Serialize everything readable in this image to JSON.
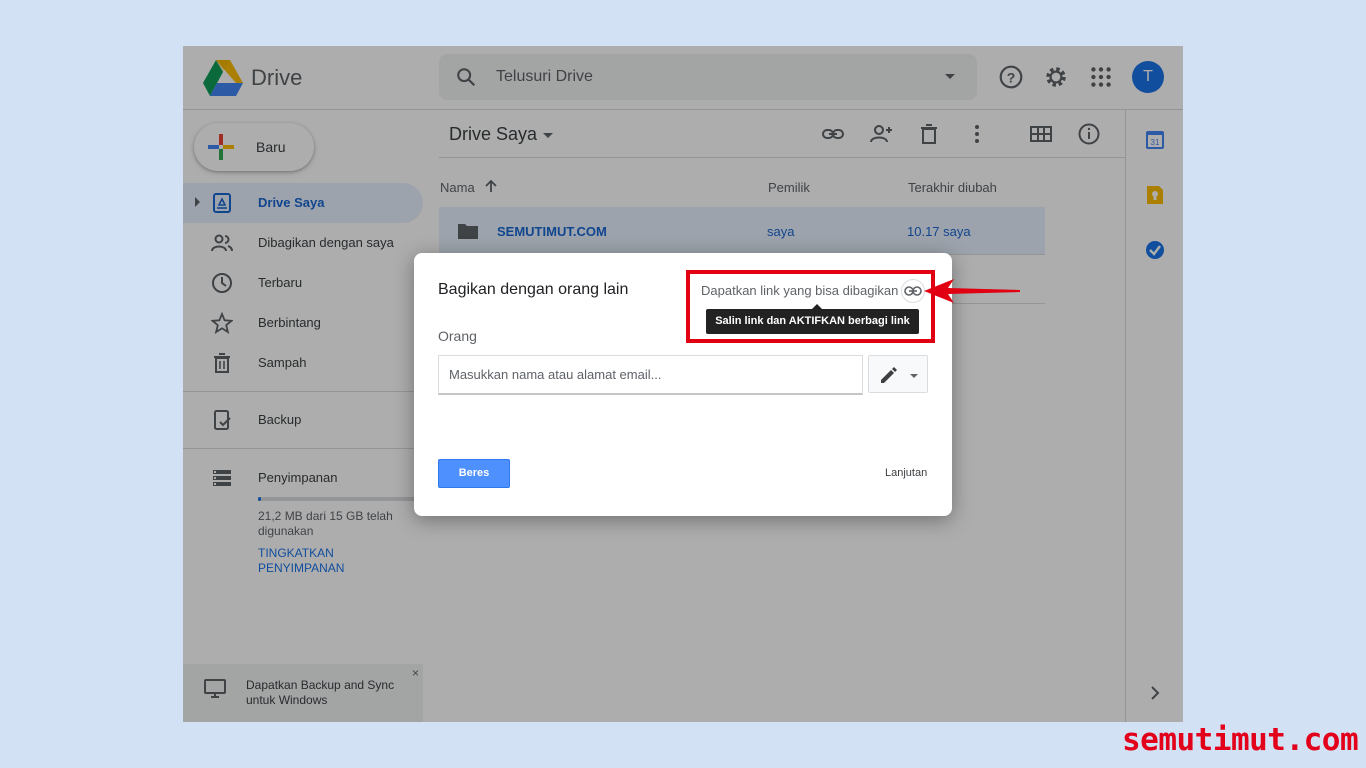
{
  "app": {
    "name": "Drive"
  },
  "search": {
    "placeholder": "Telusuri Drive"
  },
  "user": {
    "avatar_letter": "T"
  },
  "sidebar": {
    "new_label": "Baru",
    "items": [
      {
        "label": "Drive Saya",
        "icon": "drive-folder-icon",
        "active": true
      },
      {
        "label": "Dibagikan dengan saya",
        "icon": "people-icon"
      },
      {
        "label": "Terbaru",
        "icon": "clock-icon"
      },
      {
        "label": "Berbintang",
        "icon": "star-icon"
      },
      {
        "label": "Sampah",
        "icon": "trash-icon"
      },
      {
        "label": "Backup",
        "icon": "backup-icon"
      },
      {
        "label": "Penyimpanan",
        "icon": "storage-icon"
      }
    ],
    "storage_used_fraction": 0.01,
    "storage_text": "21,2 MB dari 15 GB telah digunakan",
    "upgrade_label": "TINGKATKAN PENYIMPANAN",
    "promo_text": "Dapatkan Backup and Sync untuk Windows",
    "promo_close": "×"
  },
  "main": {
    "title": "Drive Saya",
    "columns": {
      "name": "Nama",
      "owner": "Pemilik",
      "modified": "Terakhir diubah"
    },
    "rows": [
      {
        "name": "SEMUTIMUT.COM",
        "owner": "saya",
        "modified": "10.17  saya"
      },
      {
        "name": "",
        "owner": "",
        "modified": "aya"
      }
    ]
  },
  "dialog": {
    "title": "Bagikan dengan orang lain",
    "link_label": "Dapatkan link yang bisa dibagikan",
    "people_label": "Orang",
    "input_placeholder": "Masukkan nama atau alamat email...",
    "done_label": "Beres",
    "advanced_label": "Lanjutan"
  },
  "tooltip": {
    "text": "Salin link dan AKTIFKAN berbagi link"
  },
  "watermark": {
    "text": "semutimut.com"
  },
  "colors": {
    "highlight": "#e00012",
    "accent": "#1a73e8",
    "watermark": "#e3001b"
  }
}
